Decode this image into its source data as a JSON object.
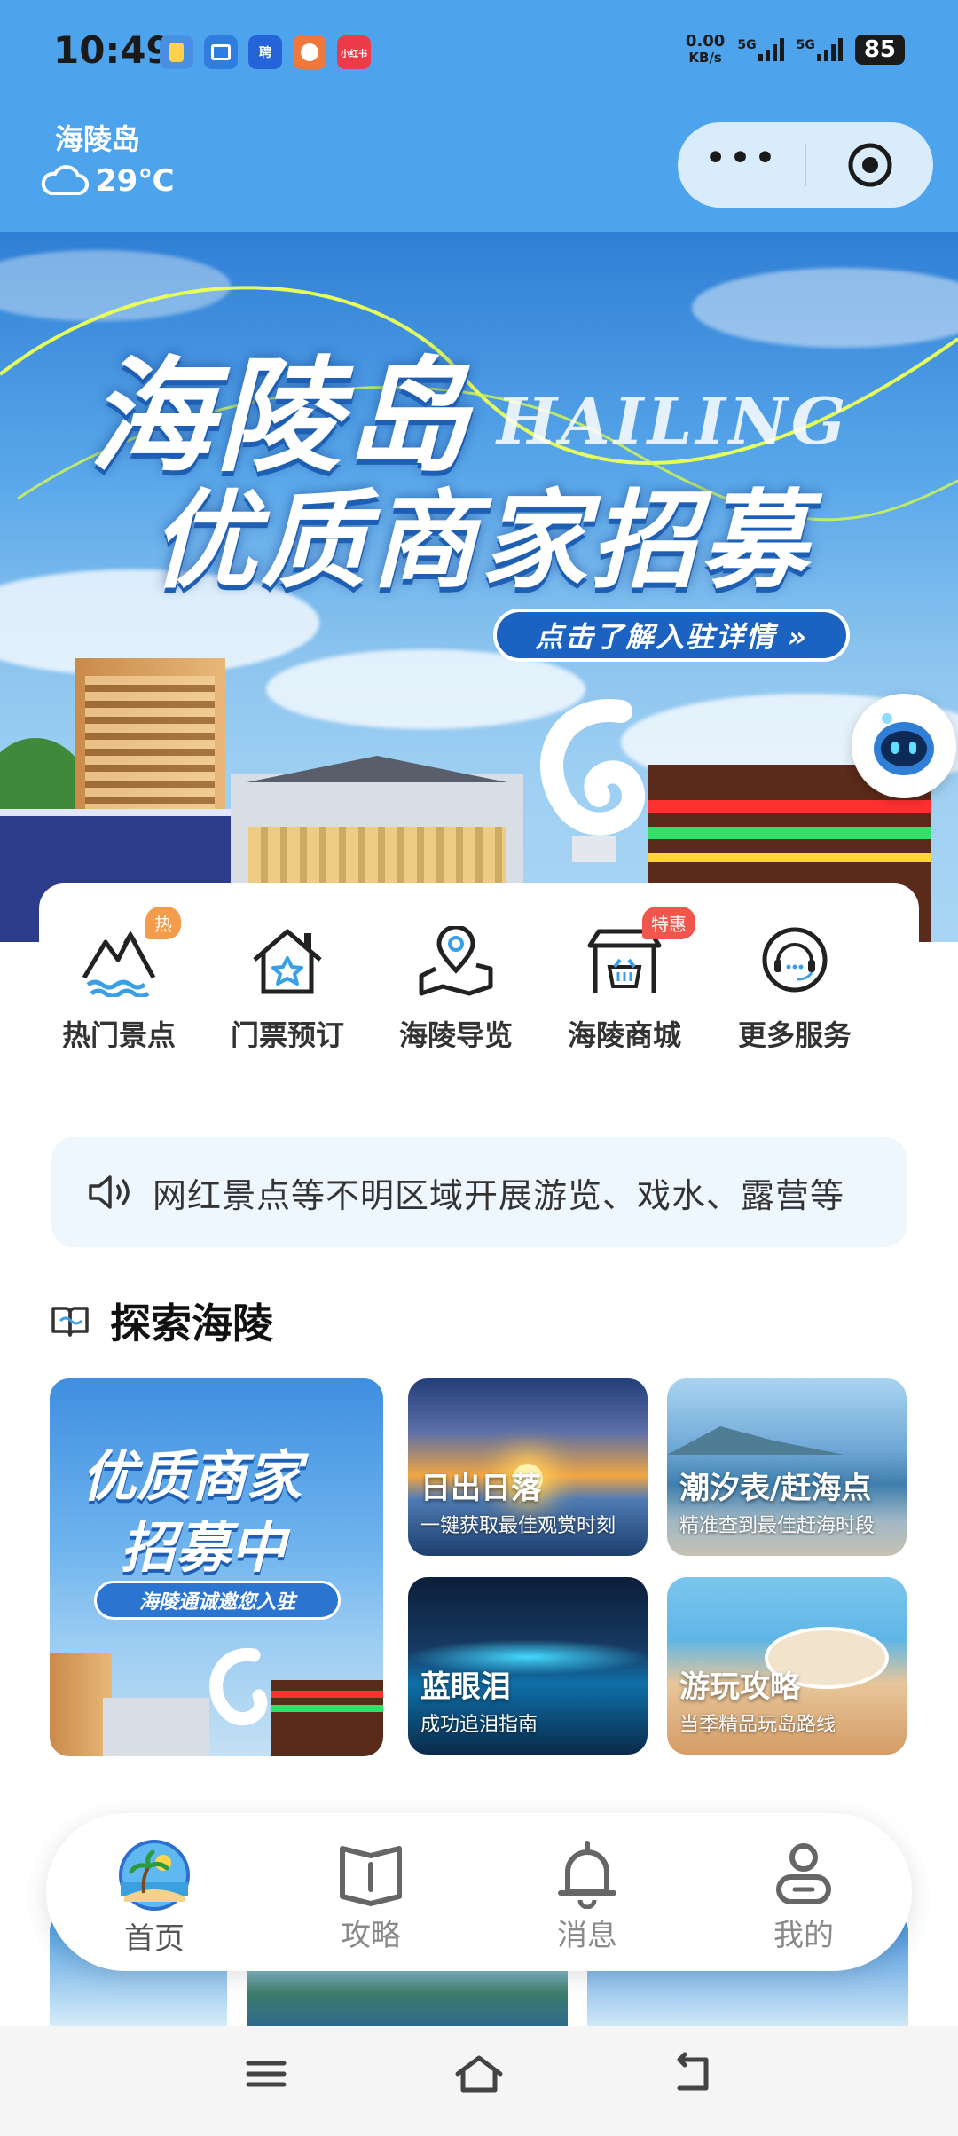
{
  "status_bar": {
    "time": "10:49",
    "apps": [
      {
        "name": "app-icon-1",
        "color": "#4a90e2",
        "text": ""
      },
      {
        "name": "app-icon-2",
        "color": "#2f7de1",
        "text": ""
      },
      {
        "name": "app-icon-3",
        "color": "#2563d9",
        "text": "聘"
      },
      {
        "name": "app-icon-4",
        "color": "#f0783c",
        "text": ""
      },
      {
        "name": "app-icon-5",
        "color": "#ee3b4a",
        "text": "小红书"
      }
    ],
    "net_speed": "0.00",
    "net_unit": "KB/s",
    "signal1_label": "5G",
    "signal2_label": "5G",
    "battery": "85"
  },
  "header": {
    "location": "海陵岛",
    "temperature": "29℃"
  },
  "banner": {
    "title_line1": "海陵岛",
    "title_en": "HAILING",
    "title_line2": "优质商家招募",
    "cta": "点击了解入驻详情 »"
  },
  "quick_services": [
    {
      "label": "热门景点",
      "badge": "热"
    },
    {
      "label": "门票预订",
      "badge": ""
    },
    {
      "label": "海陵导览",
      "badge": ""
    },
    {
      "label": "海陵商城",
      "badge": "特惠"
    },
    {
      "label": "更多服务",
      "badge": ""
    }
  ],
  "notice": {
    "text": "网红景点等不明区域开展游览、戏水、露营等"
  },
  "explore": {
    "title": "探索海陵",
    "feature": {
      "line1": "优质商家",
      "line2": "招募中",
      "pill": "海陵通诚邀您入驻"
    },
    "tiles": [
      {
        "title": "日出日落",
        "subtitle": "一键获取最佳观赏时刻"
      },
      {
        "title": "潮汐表/赶海点",
        "subtitle": "精准查到最佳赶海时段"
      },
      {
        "title": "蓝眼泪",
        "subtitle": "成功追泪指南"
      },
      {
        "title": "游玩攻略",
        "subtitle": "当季精品玩岛路线"
      }
    ]
  },
  "tabbar": [
    {
      "label": "首页",
      "active": true
    },
    {
      "label": "攻略",
      "active": false
    },
    {
      "label": "消息",
      "active": false
    },
    {
      "label": "我的",
      "active": false
    }
  ]
}
